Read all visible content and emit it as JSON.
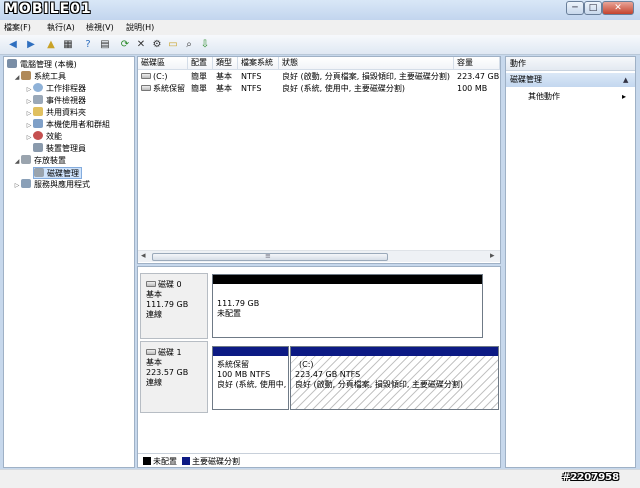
{
  "watermark": {
    "logo": "MOBILE01",
    "id": "#2207958"
  },
  "window": {
    "min": "─",
    "max": "□",
    "close": "✕"
  },
  "menu": [
    "檔案(F)",
    "執行(A)",
    "檢視(V)",
    "說明(H)"
  ],
  "toolbar": {
    "icons": [
      "back-icon",
      "forward-icon",
      "up-folder-icon",
      "console-tree-icon",
      "help-icon",
      "properties-icon",
      "refresh-icon",
      "delete-icon",
      "settings-icon",
      "open-icon",
      "find-icon",
      "export-icon"
    ],
    "glyphs": [
      "◀",
      "▶",
      "▲",
      "▦",
      "?",
      "▤",
      "⟳",
      "✕",
      "⚙",
      "▭",
      "⌕",
      "⇩"
    ]
  },
  "tree": {
    "root": "電腦管理 (本機)",
    "system_tools": "系統工具",
    "task_scheduler": "工作排程器",
    "event_viewer": "事件檢視器",
    "shared_folders": "共用資料夾",
    "local_users": "本機使用者和群組",
    "performance": "效能",
    "device_manager": "裝置管理員",
    "storage": "存放裝置",
    "disk_management": "磁碟管理",
    "services": "服務與應用程式"
  },
  "volumes": {
    "columns": [
      "磁碟區",
      "配置",
      "類型",
      "檔案系統",
      "狀態",
      "容量"
    ],
    "rows": [
      [
        "(C:)",
        "簡單",
        "基本",
        "NTFS",
        "良好 (啟動, 分頁檔案, 損毀傾印, 主要磁碟分割)",
        "223.47 GB"
      ],
      [
        "系統保留",
        "簡單",
        "基本",
        "NTFS",
        "良好 (系統, 使用中, 主要磁碟分割)",
        "100 MB"
      ]
    ],
    "scroll_left": "◂",
    "scroll_right": "▸",
    "grip": "≡"
  },
  "disks": [
    {
      "name": "磁碟 0",
      "type": "基本",
      "size": "111.79 GB",
      "state": "連線",
      "partitions": [
        {
          "title": "",
          "size": "111.79 GB",
          "status": "未配置"
        }
      ]
    },
    {
      "name": "磁碟 1",
      "type": "基本",
      "size": "223.57 GB",
      "state": "連線",
      "partitions": [
        {
          "title": "系統保留",
          "size": "100 MB NTFS",
          "status": "良好 (系統, 使用中,"
        },
        {
          "title": "(C:)",
          "size": "223.47 GB NTFS",
          "status": "良好 (啟動, 分頁檔案, 損毀傾印, 主要磁碟分割)"
        }
      ]
    }
  ],
  "legend": [
    {
      "label": "未配置",
      "color": "#000000"
    },
    {
      "label": "主要磁碟分割",
      "color": "#0c1a84"
    }
  ],
  "actions": {
    "header": "動作",
    "section": "磁碟管理",
    "section_arrow": "▲",
    "item": "其他動作",
    "item_arrow": "▸"
  }
}
